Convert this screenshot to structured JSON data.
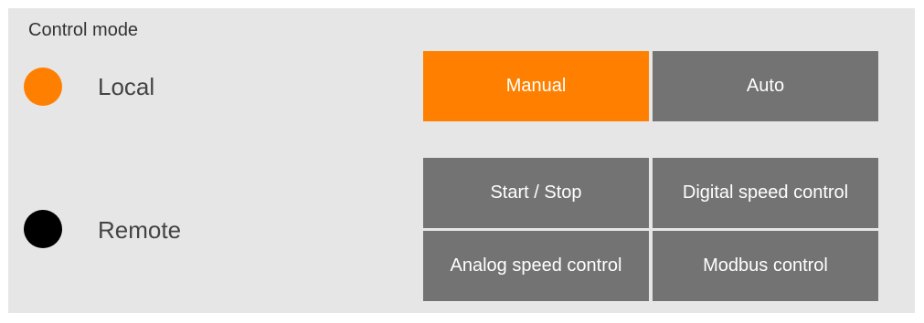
{
  "title": "Control mode",
  "modes": {
    "local": {
      "label": "Local",
      "indicator_color": "#ff8000",
      "active": true
    },
    "remote": {
      "label": "Remote",
      "indicator_color": "#000000",
      "active": false
    }
  },
  "local_buttons": {
    "manual": {
      "label": "Manual",
      "selected": true
    },
    "auto": {
      "label": "Auto",
      "selected": false
    }
  },
  "remote_buttons": {
    "start_stop": {
      "label": "Start / Stop",
      "selected": false
    },
    "digital_speed": {
      "label": "Digital speed control",
      "selected": false
    },
    "analog_speed": {
      "label": "Analog speed control",
      "selected": false
    },
    "modbus": {
      "label": "Modbus control",
      "selected": false
    }
  },
  "colors": {
    "accent": "#ff8000",
    "button_default": "#737373",
    "panel_background": "#e6e6e6"
  }
}
